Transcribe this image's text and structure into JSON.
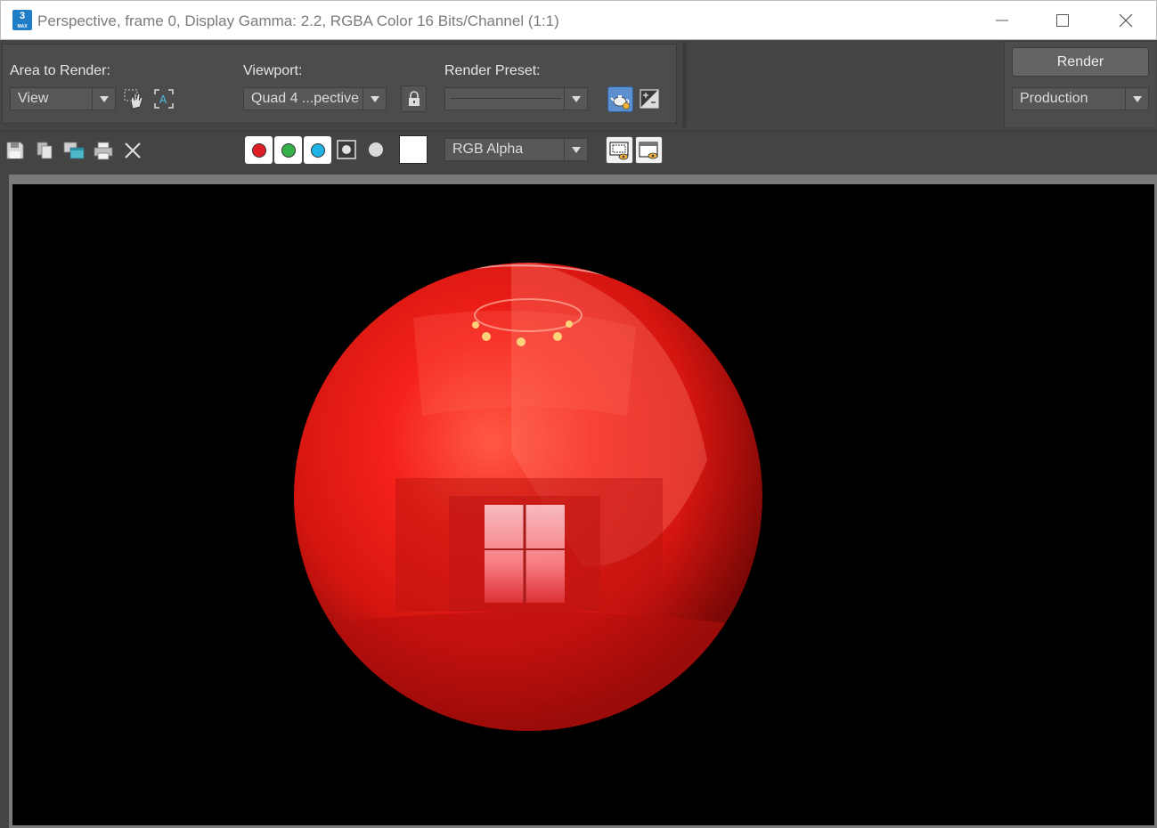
{
  "window": {
    "title": "Perspective, frame 0, Display Gamma: 2.2, RGBA Color 16 Bits/Channel (1:1)",
    "app_icon_label": "3",
    "app_icon_sublabel": "MAX"
  },
  "settings": {
    "area_label": "Area to Render:",
    "area_value": "View",
    "viewport_label": "Viewport:",
    "viewport_value": "Quad 4 ...pective",
    "preset_label": "Render Preset:",
    "preset_value": ""
  },
  "render": {
    "button_label": "Render",
    "mode_value": "Production"
  },
  "toolbar": {
    "channel_display_value": "RGB Alpha",
    "icons": [
      "save-icon",
      "copy-icon",
      "clone-window-icon",
      "print-icon",
      "clear-icon"
    ],
    "channel_colors": {
      "red": "#e01e27",
      "green": "#35b04a",
      "blue": "#1fb3e6"
    }
  },
  "colors": {
    "panel_bg": "#454545",
    "viewport_bg": "#000000",
    "sphere": "#e81c10"
  }
}
